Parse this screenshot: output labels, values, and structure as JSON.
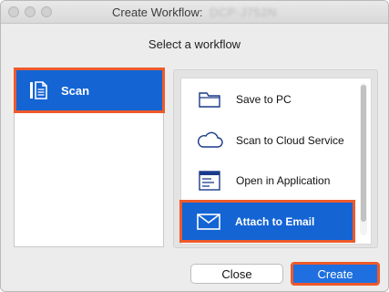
{
  "window": {
    "title": "Create Workflow:",
    "device_name": "DCP-J752N"
  },
  "heading": "Select a workflow",
  "categories": [
    {
      "label": "Scan",
      "icon": "scan-document-icon",
      "selected": true
    }
  ],
  "workflows": [
    {
      "label": "Save to PC",
      "icon": "folder-icon",
      "selected": false
    },
    {
      "label": "Scan to Cloud Service",
      "icon": "cloud-icon",
      "selected": false
    },
    {
      "label": "Open in Application",
      "icon": "application-window-icon",
      "selected": false
    },
    {
      "label": "Attach to Email",
      "icon": "envelope-icon",
      "selected": true
    }
  ],
  "buttons": {
    "close": "Close",
    "create": "Create"
  },
  "colors": {
    "selection": "#1464d4",
    "highlight_outline": "#ee5a2a"
  }
}
